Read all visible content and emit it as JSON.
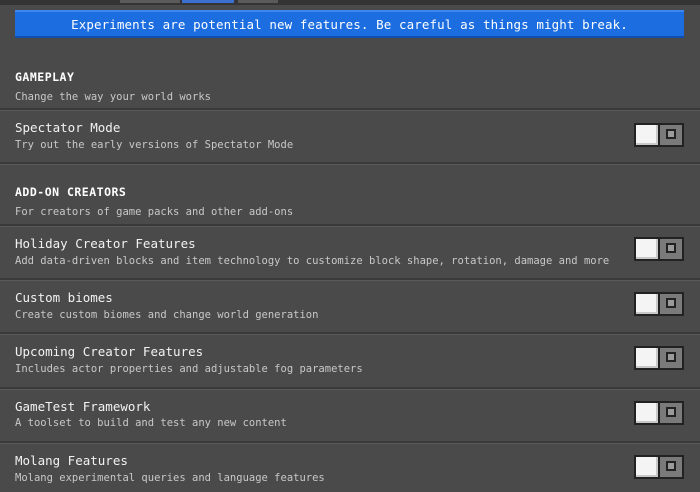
{
  "banner": {
    "text": "Experiments are potential new features. Be careful as things might break."
  },
  "sections": [
    {
      "title": "GAMEPLAY",
      "description": "Change the way your world works",
      "items": [
        {
          "title": "Spectator Mode",
          "description": "Try out the early versions of Spectator Mode",
          "enabled": false
        }
      ]
    },
    {
      "title": "ADD-ON CREATORS",
      "description": "For creators of game packs and other add-ons",
      "items": [
        {
          "title": "Holiday Creator Features",
          "description": "Add data-driven blocks and item technology to customize block shape, rotation, damage and more",
          "enabled": false
        },
        {
          "title": "Custom biomes",
          "description": "Create custom biomes and change world generation",
          "enabled": false
        },
        {
          "title": "Upcoming Creator Features",
          "description": "Includes actor properties and adjustable fog parameters",
          "enabled": false
        },
        {
          "title": "GameTest Framework",
          "description": "A toolset to build and test any new content",
          "enabled": false
        },
        {
          "title": "Molang Features",
          "description": "Molang experimental queries and language features",
          "enabled": false
        }
      ]
    }
  ],
  "colors": {
    "background": "#4a4a4a",
    "banner": "#1b6de0",
    "toggle_off": "#7a7a7a"
  }
}
